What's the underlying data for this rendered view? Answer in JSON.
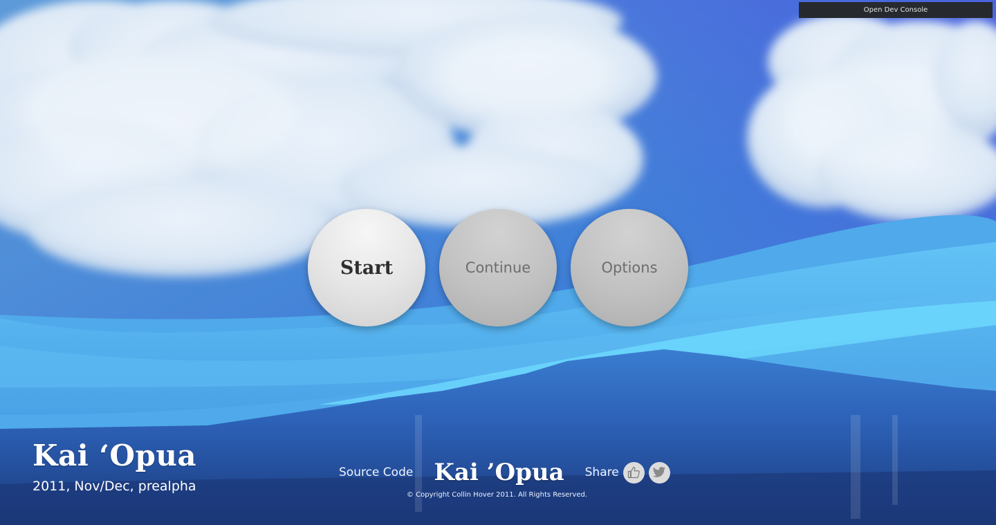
{
  "toolbar": {
    "dev_console_label": "Open Dev Console"
  },
  "menu": {
    "start_label": "Start",
    "continue_label": "Continue",
    "options_label": "Options"
  },
  "game": {
    "title": "Kai ‘Opua",
    "subtitle": "2011, Nov/Dec, prealpha"
  },
  "footer": {
    "source_code_label": "Source Code",
    "logo_text": "Kai ’Opua",
    "share_label": "Share",
    "share_icons": [
      "thumbs-up-icon",
      "twitter-bird-icon"
    ],
    "copyright": "© Copyright Collin Hover 2011. All Rights Reserved."
  },
  "colors": {
    "sky_top": "#3f6ed8",
    "sky_bottom": "#5aa6ec",
    "water_light": "#67d4fb",
    "water_deep": "#1e3f80",
    "dev_console_bg": "#26292e",
    "primary_button": "#e6e6e6",
    "secondary_button": "#c1c1c1"
  }
}
